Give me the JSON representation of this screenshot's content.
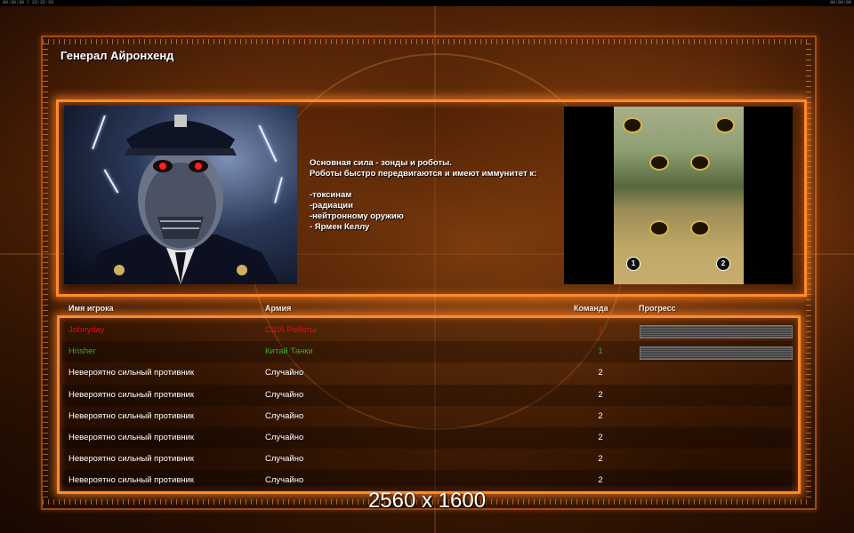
{
  "status_bar": {
    "left_text": "00:30:30 | 23:32:33",
    "right_text": "00:00:00"
  },
  "general": {
    "title": "Генерал Айронхенд",
    "description_lines": [
      "Основная сила - зонды и роботы.",
      "Роботы быстро передвигаются и имеют иммунитет к:",
      "",
      "-токсинам",
      "-радиации",
      "-нейтронному оружию",
      "- Ярмен Келлу"
    ]
  },
  "minimap": {
    "start_positions": [
      "1",
      "2"
    ]
  },
  "players_table": {
    "headers": {
      "name": "Имя игрока",
      "army": "Армия",
      "team": "Команда",
      "progress": "Прогресс"
    },
    "rows": [
      {
        "name": "Johnyday",
        "army": "США  Роботы",
        "team": "1",
        "progress": 1.0,
        "color": "#e01010",
        "army_color": "#e01010",
        "team_color": "#e01010"
      },
      {
        "name": "Hrisher",
        "army": "Китай  Танки",
        "team": "1",
        "progress": 1.0,
        "color": "#30b020",
        "army_color": "#30b020",
        "team_color": "#30b020"
      },
      {
        "name": "Невероятно сильный противник",
        "army": "Случайно",
        "team": "2",
        "color": "#ffffff",
        "army_color": "#ffffff",
        "team_color": "#ffffff"
      },
      {
        "name": "Невероятно сильный противник",
        "army": "Случайно",
        "team": "2",
        "color": "#ffffff",
        "army_color": "#ffffff",
        "team_color": "#ffffff"
      },
      {
        "name": "Невероятно сильный противник",
        "army": "Случайно",
        "team": "2",
        "color": "#ffffff",
        "army_color": "#ffffff",
        "team_color": "#ffffff"
      },
      {
        "name": "Невероятно сильный противник",
        "army": "Случайно",
        "team": "2",
        "color": "#ffffff",
        "army_color": "#ffffff",
        "team_color": "#ffffff"
      },
      {
        "name": "Невероятно сильный противник",
        "army": "Случайно",
        "team": "2",
        "color": "#ffffff",
        "army_color": "#ffffff",
        "team_color": "#ffffff"
      },
      {
        "name": "Невероятно сильный противник",
        "army": "Случайно",
        "team": "2",
        "color": "#ffffff",
        "army_color": "#ffffff",
        "team_color": "#ffffff"
      }
    ]
  },
  "footer": {
    "resolution_label": "2560 x 1600"
  },
  "colors": {
    "panel_border": "#ff8a2a",
    "player_red": "#e01010",
    "player_green": "#30b020"
  }
}
